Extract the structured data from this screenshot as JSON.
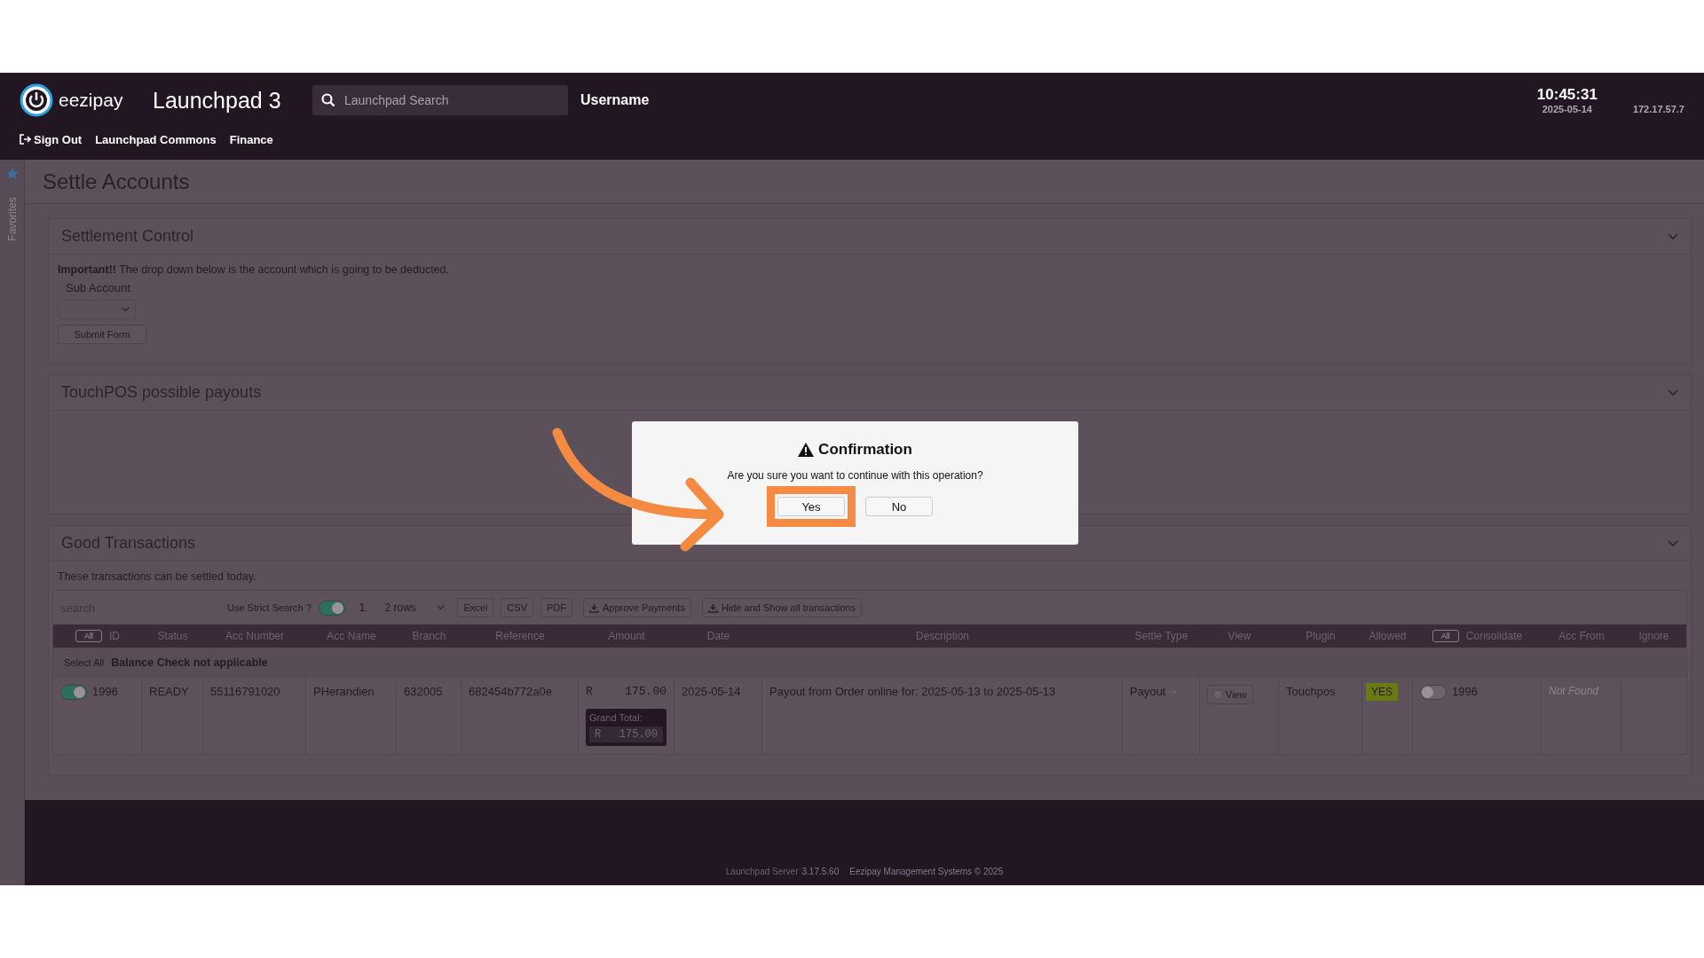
{
  "header": {
    "brand": "eezipay",
    "app_title": "Launchpad 3",
    "search": {
      "placeholder": "Launchpad Search"
    },
    "username": "Username",
    "time": "10:45:31",
    "date": "2025-05-14",
    "ip": "172.17.57.7",
    "nav": [
      {
        "label": "Sign Out",
        "kind": "signout"
      },
      {
        "label": "Launchpad Commons",
        "kind": "link"
      },
      {
        "label": "Finance",
        "kind": "link"
      }
    ]
  },
  "sidebar": {
    "label": "Favorites"
  },
  "page_title": "Settle Accounts",
  "settlement_control": {
    "title": "Settlement Control",
    "note": "**Important!!** The drop down below is the account which is going to be deducted.",
    "sub_account_label": "Sub Account",
    "submit": "Submit Form"
  },
  "touchpos": {
    "title": "TouchPOS possible payouts"
  },
  "good_transactions": {
    "title": "Good Transactions",
    "note": "These transactions can be settled today.",
    "toolbar": {
      "search": {
        "placeholder": "search"
      },
      "strict_label": "Use Strict Search ?",
      "strict_on": true,
      "page": "1",
      "rows": "2 rows",
      "exports": [
        "Excel",
        "CSV",
        "PDF"
      ],
      "actions": [
        "Approve Payments",
        "Hide and Show all transactions"
      ]
    },
    "columns": [
      {
        "label": "ID",
        "chip": "All"
      },
      {
        "label": "Status"
      },
      {
        "label": "Acc Number"
      },
      {
        "label": "Acc Name"
      },
      {
        "label": "Branch"
      },
      {
        "label": "Reference"
      },
      {
        "label": "Amount"
      },
      {
        "label": "Date"
      },
      {
        "label": "Description"
      },
      {
        "label": "Settle Type"
      },
      {
        "label": "View"
      },
      {
        "label": "Plugin"
      },
      {
        "label": "Allowed"
      },
      {
        "label": "Consolidate",
        "chip": "All"
      },
      {
        "label": "Acc From"
      },
      {
        "label": "Ignore"
      }
    ],
    "group": {
      "select_all": "Select All",
      "label": "Balance Check not applicable"
    },
    "rows": [
      {
        "selected": true,
        "id": "1996",
        "status": "READY",
        "acc_number": "55116791020",
        "acc_name": "PHerandien",
        "branch": "632005",
        "reference": "682454b772a0e",
        "currency": "R",
        "amount": "175.00",
        "date": "2025-05-14",
        "description": "Payout from Order online for: 2025-05-13 to 2025-05-13",
        "settle_type": "Payout",
        "view": "View",
        "plugin": "Touchpos",
        "allowed": "YES",
        "consolidate": false,
        "consolidate_id": "1996",
        "acc_from": "Not Found"
      }
    ],
    "grand_total": {
      "label": "Grand Total:",
      "currency": "R",
      "value": "175.00"
    }
  },
  "footer": {
    "server_label": "Launchpad Server",
    "version": "3.17.5.60",
    "copyright": "Eezipay Management Systems © 2025"
  },
  "dialog": {
    "title": "Confirmation",
    "message": "Are you sure you want to continue with this operation?",
    "buttons": [
      {
        "label": "Yes",
        "highlighted": true
      },
      {
        "label": "No",
        "highlighted": false
      }
    ]
  }
}
